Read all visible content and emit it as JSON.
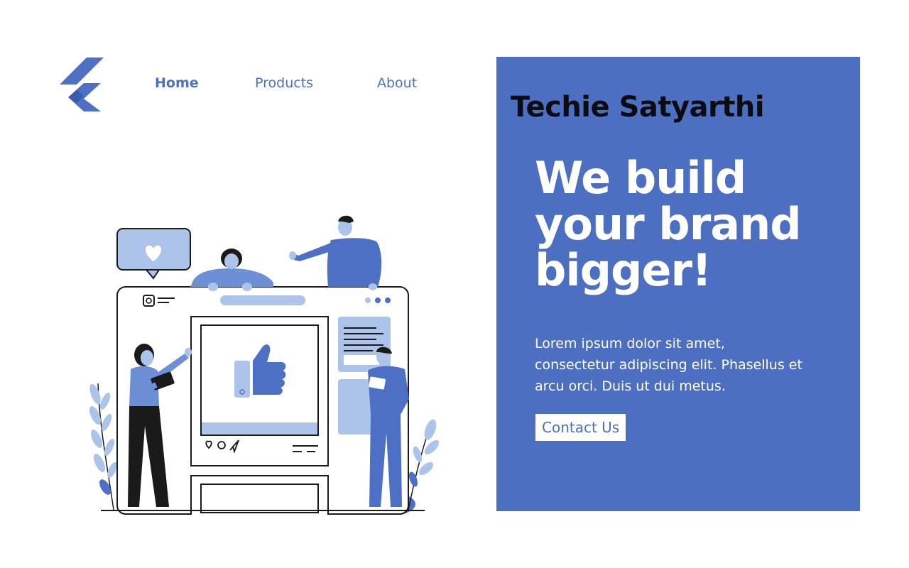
{
  "nav": {
    "home": "Home",
    "products": "Products",
    "about": "About"
  },
  "brand": "Techie Satyarthi",
  "hero": {
    "headline": "We build your brand bigger!",
    "body": "Lorem ipsum dolor sit amet, consectetur adipiscing elit. Phasellus et arcu orci. Duis ut dui metus.",
    "cta": "Contact Us"
  },
  "colors": {
    "accent": "#4d6fc2",
    "light_accent": "#adc4ea",
    "brand_text": "#0b0b12"
  },
  "icons": [
    "flutter-logo-icon",
    "heart-bubble-icon",
    "thumbs-up-icon",
    "instagram-icon",
    "heart-icon",
    "comment-icon",
    "send-icon"
  ]
}
